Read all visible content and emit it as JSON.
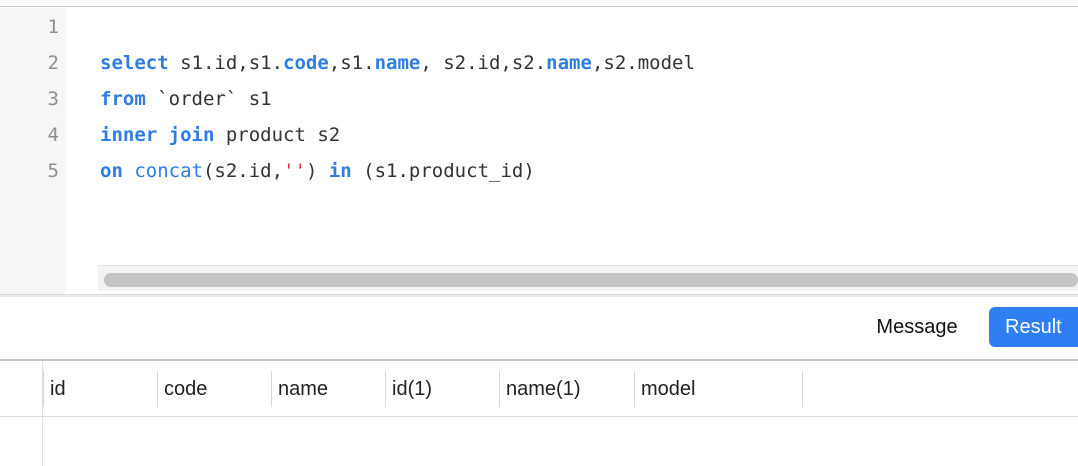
{
  "editor": {
    "line_numbers": [
      "1",
      "2",
      "3",
      "4",
      "5"
    ],
    "lines": [
      [],
      [
        {
          "t": "select",
          "c": "kw"
        },
        {
          "t": " s1.id,s1.",
          "c": ""
        },
        {
          "t": "code",
          "c": "kw"
        },
        {
          "t": ",s1.",
          "c": ""
        },
        {
          "t": "name",
          "c": "kw"
        },
        {
          "t": ", s2.id,s2.",
          "c": ""
        },
        {
          "t": "name",
          "c": "kw"
        },
        {
          "t": ",s2.model",
          "c": ""
        }
      ],
      [
        {
          "t": "from",
          "c": "kw"
        },
        {
          "t": " `order` s1",
          "c": ""
        }
      ],
      [
        {
          "t": "inner",
          "c": "kw"
        },
        {
          "t": " ",
          "c": ""
        },
        {
          "t": "join",
          "c": "kw"
        },
        {
          "t": " product s2",
          "c": ""
        }
      ],
      [
        {
          "t": "on",
          "c": "kw"
        },
        {
          "t": " ",
          "c": ""
        },
        {
          "t": "concat",
          "c": "fn"
        },
        {
          "t": "(s2.id,",
          "c": ""
        },
        {
          "t": "''",
          "c": "str"
        },
        {
          "t": ") ",
          "c": ""
        },
        {
          "t": "in",
          "c": "kw"
        },
        {
          "t": " (s1.product_id)",
          "c": ""
        }
      ]
    ]
  },
  "tabs": {
    "message_label": "Message",
    "result_label": "Result"
  },
  "grid": {
    "columns": [
      "id",
      "code",
      "name",
      "id(1)",
      "name(1)",
      "model"
    ]
  },
  "colors": {
    "keyword": "#2f7de1",
    "string": "#e0344a",
    "accent": "#2f7ff2"
  }
}
